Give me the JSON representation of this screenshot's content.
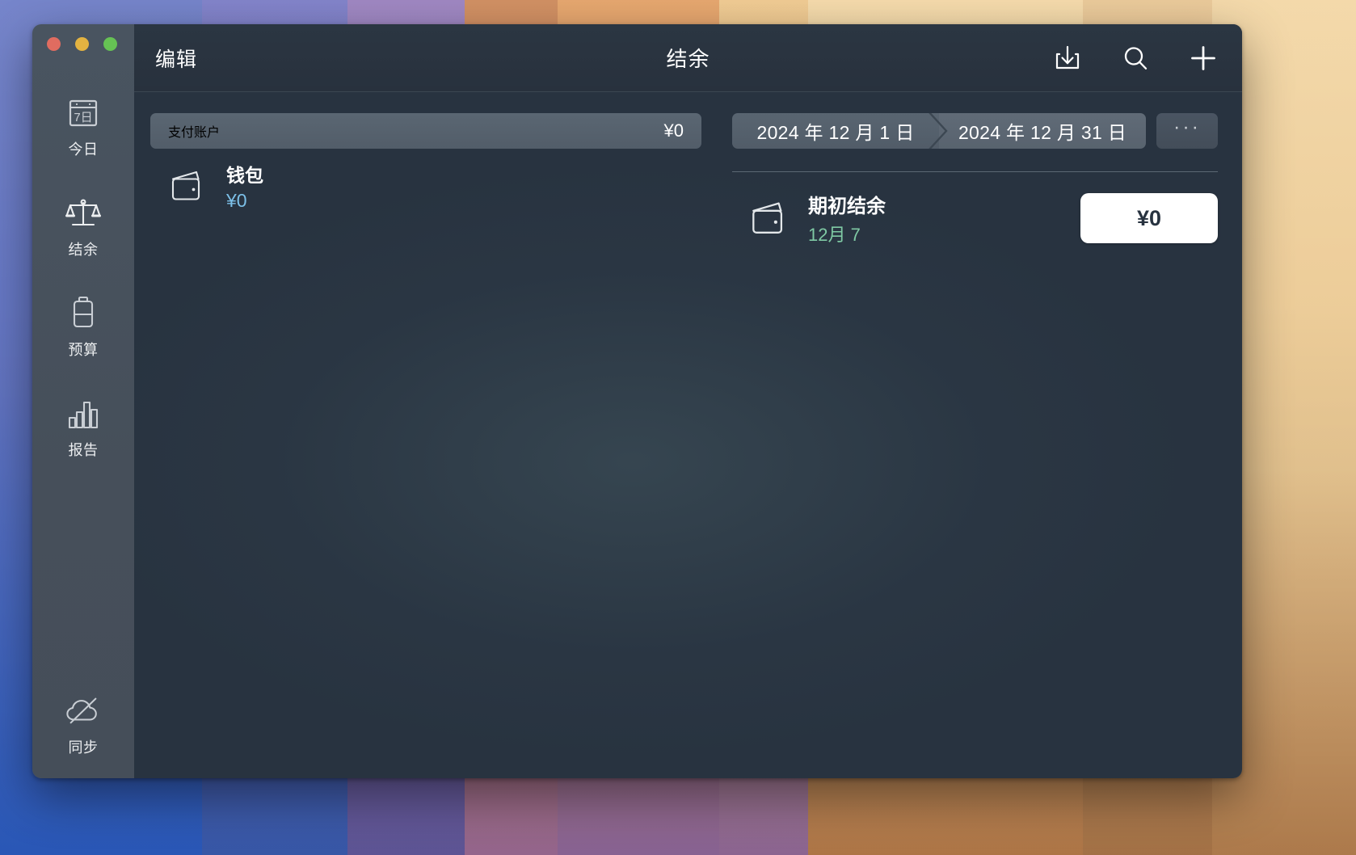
{
  "window": {
    "title": "结余",
    "edit_label": "编辑",
    "traffic_lights": [
      "close-button",
      "minimize-button",
      "maximize-button"
    ],
    "actions": [
      {
        "name": "import-icon",
        "label": "导入"
      },
      {
        "name": "search-icon",
        "label": "搜索"
      },
      {
        "name": "add-icon",
        "label": "添加"
      }
    ]
  },
  "sidebar": {
    "items": [
      {
        "label": "今日",
        "icon": "calendar-icon",
        "badge": "7日",
        "selected": false
      },
      {
        "label": "结余",
        "icon": "scales-icon",
        "selected": true
      },
      {
        "label": "预算",
        "icon": "battery-icon",
        "selected": false
      },
      {
        "label": "报告",
        "icon": "bar-chart-icon",
        "selected": false
      }
    ],
    "sync": {
      "label": "同步",
      "icon": "cloud-slash-icon"
    }
  },
  "left_pane": {
    "group": {
      "name": "支付账户",
      "total": "¥0"
    },
    "accounts": [
      {
        "name": "钱包",
        "balance": "¥0",
        "icon": "wallet-icon"
      }
    ]
  },
  "right_pane": {
    "date_range": {
      "start": "2024 年 12 月 1 日",
      "end": "2024 年 12 月 31 日",
      "more_label": "···"
    },
    "rows": [
      {
        "name": "期初结余",
        "date": "12月 7",
        "amount": "¥0",
        "icon": "wallet-icon"
      }
    ]
  },
  "colors": {
    "window_bg": "#283340",
    "sidebar_bg": "#465059",
    "titlebar_bg": "#2b3642",
    "accent_blue": "#7cc0e8",
    "accent_green": "#7fc9a4",
    "pill_bg": "#566personally"
  }
}
